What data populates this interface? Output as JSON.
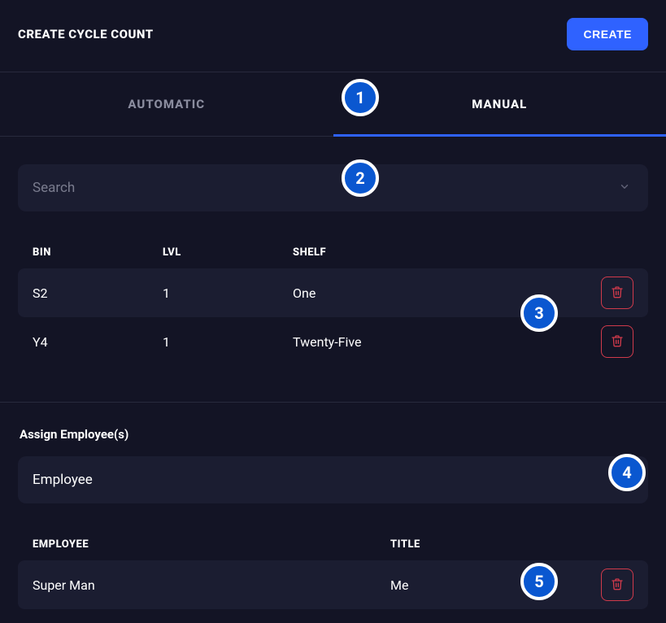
{
  "header": {
    "title": "CREATE CYCLE COUNT",
    "create_label": "CREATE"
  },
  "tabs": {
    "automatic": "AUTOMATIC",
    "manual": "MANUAL",
    "active": "manual"
  },
  "search": {
    "placeholder": "Search"
  },
  "bin_table": {
    "headers": {
      "bin": "BIN",
      "lvl": "LVL",
      "shelf": "SHELF"
    },
    "rows": [
      {
        "bin": "S2",
        "lvl": "1",
        "shelf": "One"
      },
      {
        "bin": "Y4",
        "lvl": "1",
        "shelf": "Twenty-Five"
      }
    ]
  },
  "assign_section": {
    "heading": "Assign Employee(s)",
    "selected": "Employee"
  },
  "employee_table": {
    "headers": {
      "employee": "EMPLOYEE",
      "title": "TITLE"
    },
    "rows": [
      {
        "employee": "Super Man",
        "title": "Me"
      }
    ]
  },
  "badges": [
    "1",
    "2",
    "3",
    "4",
    "5"
  ],
  "icons": {
    "trash": "trash-icon",
    "chevron_down": "chevron-down-icon"
  },
  "colors": {
    "accent": "#2f62ff",
    "danger": "#d03a4b",
    "badge_bg": "#0a57d0"
  }
}
